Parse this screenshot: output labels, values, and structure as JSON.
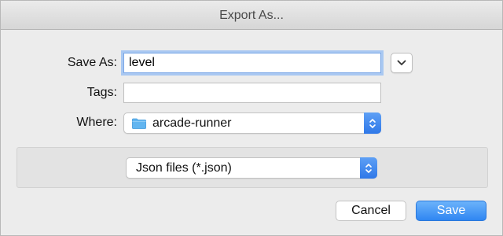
{
  "window": {
    "title": "Export As..."
  },
  "form": {
    "save_as_label": "Save As:",
    "save_as_value": "level",
    "tags_label": "Tags:",
    "tags_value": "",
    "where_label": "Where:",
    "where_value": "arcade-runner",
    "where_icon": "folder-icon"
  },
  "format": {
    "selected": "Json files (*.json)"
  },
  "buttons": {
    "cancel": "Cancel",
    "save": "Save"
  },
  "colors": {
    "accent": "#2f86f2",
    "focus_ring": "#a9c8f2",
    "folder": "#62b5f0"
  }
}
